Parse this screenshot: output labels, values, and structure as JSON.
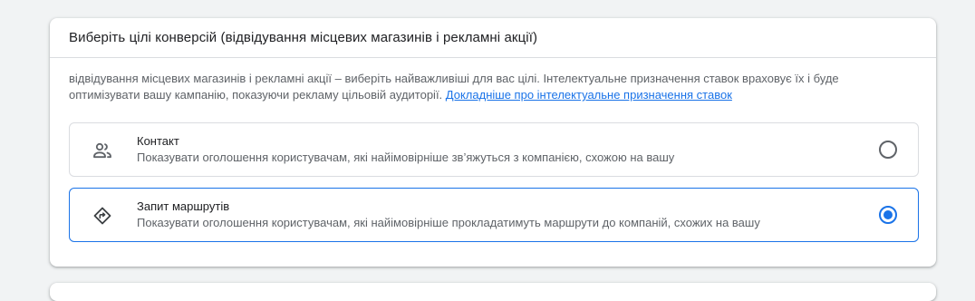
{
  "card": {
    "title": "Виберіть цілі конверсій (відвідування місцевих магазинів і рекламні акції)",
    "description": "відвідування місцевих магазинів і рекламні акції – виберіть найважливіші для вас цілі. Інтелектуальне призначення ставок враховує їх і буде оптимізувати вашу кампанію, показуючи рекламу цільовій аудиторії.",
    "link_text": "Докладніше про інтелектуальне призначення ставок"
  },
  "options": [
    {
      "title": "Контакт",
      "description": "Показувати оголошення користувачам, які найімовірніше зв’яжуться з компанією, схожою на вашу",
      "icon": "people-icon",
      "selected": false
    },
    {
      "title": "Запит маршрутів",
      "description": "Показувати оголошення користувачам, які найімовірніше прокладатимуть маршрути до компаній, схожих на вашу",
      "icon": "directions-icon",
      "selected": true
    }
  ],
  "colors": {
    "accent": "#1a73e8",
    "border": "#dadce0",
    "text_primary": "#202124",
    "text_secondary": "#5f6368",
    "background": "#f1f3f4"
  }
}
